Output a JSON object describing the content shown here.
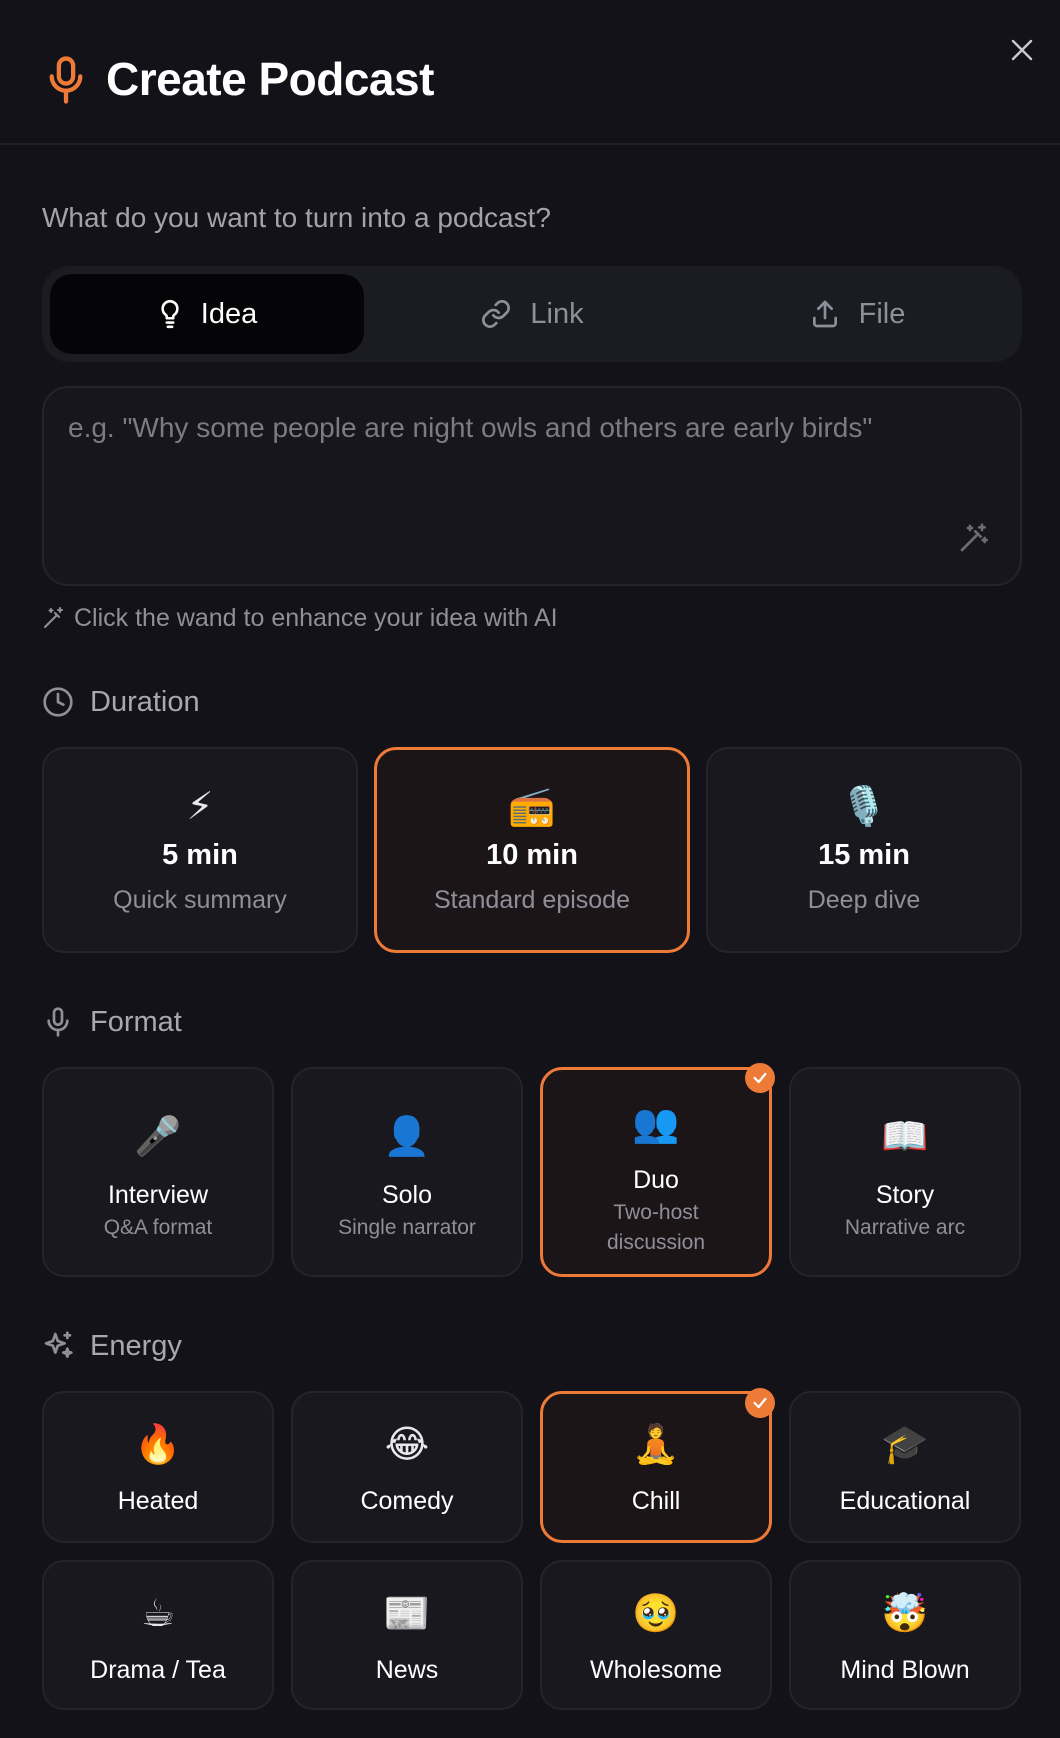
{
  "header": {
    "title": "Create Podcast",
    "icon": "microphone-icon",
    "close_icon": "close-icon"
  },
  "prompt": {
    "question": "What do you want to turn into a podcast?"
  },
  "source_tabs": [
    {
      "label": "Idea",
      "icon": "lightbulb-icon",
      "active": true
    },
    {
      "label": "Link",
      "icon": "link-icon",
      "active": false
    },
    {
      "label": "File",
      "icon": "upload-icon",
      "active": false
    }
  ],
  "idea_input": {
    "placeholder": "e.g. \"Why some people are night owls and others are early birds\"",
    "value": "",
    "wand_icon": "magic-wand-icon"
  },
  "hint": {
    "text": "Click the wand to enhance your idea with AI"
  },
  "duration": {
    "heading": "Duration",
    "icon": "clock-icon",
    "options": [
      {
        "emoji": "⚡",
        "label": "5 min",
        "sub": "Quick summary",
        "selected": false
      },
      {
        "emoji": "📻",
        "label": "10 min",
        "sub": "Standard episode",
        "selected": true
      },
      {
        "emoji": "🎙️",
        "label": "15 min",
        "sub": "Deep dive",
        "selected": false
      }
    ]
  },
  "format": {
    "heading": "Format",
    "icon": "microphone-icon",
    "options": [
      {
        "emoji": "🎤",
        "label": "Interview",
        "sub": "Q&A format",
        "selected": false
      },
      {
        "emoji": "👤",
        "label": "Solo",
        "sub": "Single narrator",
        "selected": false
      },
      {
        "emoji": "👥",
        "label": "Duo",
        "sub": "Two-host discussion",
        "selected": true
      },
      {
        "emoji": "📖",
        "label": "Story",
        "sub": "Narrative arc",
        "selected": false
      }
    ]
  },
  "energy": {
    "heading": "Energy",
    "icon": "sparkles-icon",
    "options": [
      {
        "emoji": "🔥",
        "label": "Heated",
        "selected": false
      },
      {
        "emoji": "😂",
        "label": "Comedy",
        "selected": false
      },
      {
        "emoji": "🧘",
        "label": "Chill",
        "selected": true
      },
      {
        "emoji": "🎓",
        "label": "Educational",
        "selected": false
      },
      {
        "emoji": "☕",
        "label": "Drama / Tea",
        "selected": false
      },
      {
        "emoji": "📰",
        "label": "News",
        "selected": false
      },
      {
        "emoji": "🥹",
        "label": "Wholesome",
        "selected": false
      },
      {
        "emoji": "🤯",
        "label": "Mind Blown",
        "selected": false
      }
    ]
  },
  "colors": {
    "accent": "#ee7a38",
    "background": "#121218",
    "card": "#18181e"
  }
}
